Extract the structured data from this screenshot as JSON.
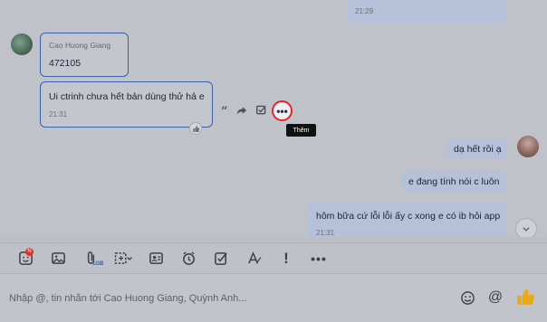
{
  "chat": {
    "top_out_time": "21:29",
    "contact_message_1": {
      "sender": "Cao Huong Giang",
      "text": "472105"
    },
    "contact_message_2": {
      "text": "Ui ctrinh chưa hết bản dùng thử hả e",
      "time": "21:31"
    },
    "hover_actions": {
      "quote_icon": "quote-icon",
      "forward_icon": "forward-icon",
      "task_icon": "task-icon",
      "more_icon": "more-icon",
      "tooltip": "Thêm"
    },
    "my_messages": [
      {
        "text": "dạ hết rồi ạ"
      },
      {
        "text": "e đang tính nói c luôn"
      },
      {
        "text": "hôm bữa cứ lỗi lỗi ấy c xong e có ib hỏi app",
        "time": "21:31"
      }
    ]
  },
  "toolbar": {
    "items": [
      {
        "icon": "sticker-icon",
        "badge": "N"
      },
      {
        "icon": "image-icon"
      },
      {
        "icon": "attach-icon",
        "sub": "1GB"
      },
      {
        "icon": "screenshot-icon"
      },
      {
        "icon": "contact-card-icon"
      },
      {
        "icon": "reminder-clock-icon"
      },
      {
        "icon": "task-assign-icon"
      },
      {
        "icon": "text-format-icon"
      },
      {
        "icon": "urgent-icon"
      },
      {
        "icon": "more-options-icon"
      }
    ]
  },
  "composer": {
    "placeholder": "Nhập @, tin nhắn tới Cao Huong Giang, Quỳnh Anh...",
    "emoji_icon": "emoji-icon",
    "mention_icon": "mention-icon",
    "like_icon": "thumbs-up-icon"
  },
  "colors": {
    "accent": "#3b5fa8",
    "highlight_ring": "#e3262a",
    "like": "#e8a818"
  }
}
